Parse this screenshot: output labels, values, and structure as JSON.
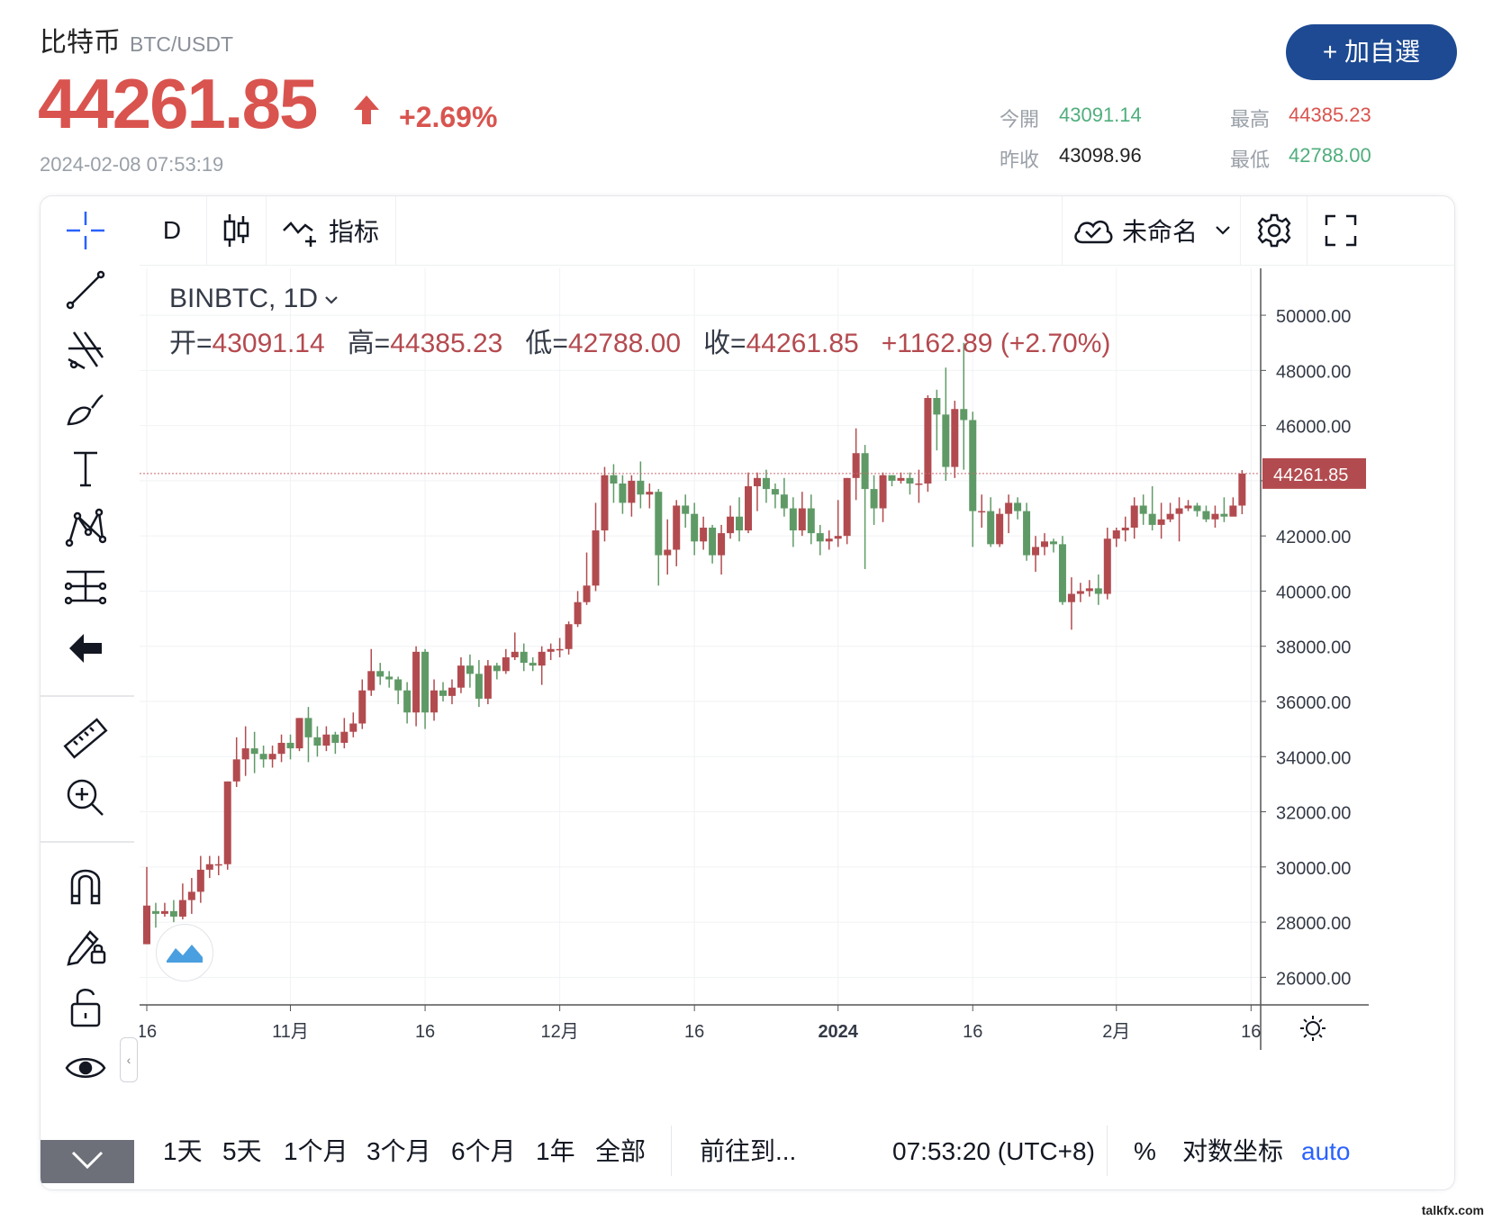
{
  "asset": {
    "name": "比特币",
    "pair": "BTC/USDT"
  },
  "price": {
    "last": "44261.85",
    "change": "+2.69%",
    "timestamp": "2024-02-08 07:53:19"
  },
  "watch_button": "+ 加自選",
  "quote": {
    "open_label": "今開",
    "open": "43091.14",
    "high_label": "最高",
    "high": "44385.23",
    "prev_label": "昨收",
    "prev": "43098.96",
    "low_label": "最低",
    "low": "42788.00"
  },
  "toolbar": {
    "interval": "D",
    "indicators": "指标",
    "layout_name": "未命名"
  },
  "legend": {
    "symbol": "BINBTC, 1D",
    "o_label": "开=",
    "o": "43091.14",
    "h_label": "高=",
    "h": "44385.23",
    "l_label": "低=",
    "l": "42788.00",
    "c_label": "收=",
    "c": "44261.85",
    "chg": "+1162.89 (+2.70%)"
  },
  "bottom": {
    "ranges": [
      "1天",
      "5天",
      "1个月",
      "3个月",
      "6个月",
      "1年",
      "全部"
    ],
    "goto": "前往到...",
    "clock": "07:53:20 (UTC+8)",
    "percent": "%",
    "log": "对数坐标",
    "auto": "auto"
  },
  "colors": {
    "up": "#b24b4f",
    "down": "#5f9a66",
    "accent": "#1e4a93",
    "price_red": "#d9544f",
    "quote_green": "#4fae7c"
  },
  "chart_data": {
    "type": "candlestick",
    "symbol": "BINBTC",
    "interval": "1D",
    "y_ticks": [
      26000,
      28000,
      30000,
      32000,
      34000,
      36000,
      38000,
      40000,
      42000,
      44000,
      46000,
      48000,
      50000
    ],
    "ylim": [
      25000,
      51700
    ],
    "x_ticks": [
      {
        "label": "16",
        "index": 0
      },
      {
        "label": "11月",
        "index": 16
      },
      {
        "label": "16",
        "index": 31
      },
      {
        "label": "12月",
        "index": 46
      },
      {
        "label": "16",
        "index": 61
      },
      {
        "label": "2024",
        "index": 77
      },
      {
        "label": "16",
        "index": 92
      },
      {
        "label": "2月",
        "index": 108
      },
      {
        "label": "16",
        "index": 123
      }
    ],
    "last_price_label": "44261.85",
    "last_price": 44262,
    "candles": [
      [
        27200,
        28600,
        27200,
        30000
      ],
      [
        28400,
        28300,
        27800,
        28700
      ],
      [
        28300,
        28400,
        28200,
        28700
      ],
      [
        28400,
        28200,
        28000,
        28800
      ],
      [
        28200,
        28800,
        28100,
        29400
      ],
      [
        28800,
        29100,
        28300,
        29600
      ],
      [
        29100,
        29900,
        28700,
        30400
      ],
      [
        29900,
        30100,
        29600,
        30400
      ],
      [
        30100,
        30100,
        29700,
        30400
      ],
      [
        30100,
        33100,
        29900,
        33100
      ],
      [
        33100,
        33900,
        32900,
        34700
      ],
      [
        33900,
        34300,
        33300,
        35100
      ],
      [
        34300,
        34100,
        33400,
        34900
      ],
      [
        34100,
        33900,
        33600,
        34400
      ],
      [
        33900,
        34100,
        33600,
        34400
      ],
      [
        34100,
        34500,
        33800,
        34800
      ],
      [
        34500,
        34300,
        33900,
        34800
      ],
      [
        34300,
        35400,
        34200,
        35400
      ],
      [
        35400,
        34700,
        33800,
        35800
      ],
      [
        34700,
        34400,
        34000,
        35100
      ],
      [
        34400,
        34800,
        34200,
        35100
      ],
      [
        34800,
        34500,
        34100,
        34900
      ],
      [
        34500,
        34900,
        34300,
        35400
      ],
      [
        34900,
        35200,
        34700,
        35600
      ],
      [
        35200,
        36400,
        35000,
        36800
      ],
      [
        36400,
        37100,
        36200,
        37900
      ],
      [
        37100,
        36900,
        36600,
        37400
      ],
      [
        36900,
        36800,
        36500,
        37100
      ],
      [
        36800,
        36400,
        35900,
        36900
      ],
      [
        36400,
        35600,
        35200,
        36700
      ],
      [
        35600,
        37800,
        35100,
        38000
      ],
      [
        37800,
        35600,
        35000,
        37900
      ],
      [
        35600,
        36400,
        35300,
        36800
      ],
      [
        36400,
        36200,
        36000,
        36700
      ],
      [
        36200,
        36500,
        35900,
        36800
      ],
      [
        36500,
        37300,
        36300,
        37600
      ],
      [
        37300,
        37000,
        36500,
        37700
      ],
      [
        37000,
        36100,
        35800,
        37500
      ],
      [
        36100,
        37300,
        35900,
        37500
      ],
      [
        37300,
        37100,
        36800,
        37400
      ],
      [
        37100,
        37600,
        37000,
        37900
      ],
      [
        37600,
        37800,
        37500,
        38500
      ],
      [
        37800,
        37400,
        37100,
        38100
      ],
      [
        37400,
        37300,
        37100,
        37600
      ],
      [
        37300,
        37800,
        36600,
        38000
      ],
      [
        37800,
        37900,
        37500,
        38100
      ],
      [
        37900,
        37900,
        37600,
        38300
      ],
      [
        37900,
        38800,
        37700,
        38900
      ],
      [
        38800,
        39600,
        38700,
        40000
      ],
      [
        39600,
        40200,
        39500,
        41400
      ],
      [
        40200,
        42200,
        40000,
        43200
      ],
      [
        42200,
        44200,
        41800,
        44500
      ],
      [
        44200,
        43900,
        43200,
        44600
      ],
      [
        43900,
        43200,
        42800,
        44200
      ],
      [
        43200,
        44000,
        42700,
        44200
      ],
      [
        44000,
        43500,
        43000,
        44700
      ],
      [
        43500,
        43600,
        43000,
        43900
      ],
      [
        43600,
        41300,
        40200,
        43700
      ],
      [
        41300,
        41500,
        40600,
        42600
      ],
      [
        41500,
        43100,
        40900,
        43300
      ],
      [
        43100,
        42800,
        42300,
        43500
      ],
      [
        42800,
        41800,
        41300,
        43200
      ],
      [
        41800,
        42300,
        41500,
        42700
      ],
      [
        42300,
        41300,
        41000,
        42400
      ],
      [
        41300,
        42100,
        40600,
        42400
      ],
      [
        42100,
        42700,
        41900,
        43100
      ],
      [
        42700,
        42200,
        41800,
        43400
      ],
      [
        42200,
        43800,
        42100,
        44300
      ],
      [
        43800,
        44100,
        42900,
        44300
      ],
      [
        44100,
        43700,
        43200,
        44400
      ],
      [
        43700,
        43500,
        43000,
        43900
      ],
      [
        43500,
        43000,
        42700,
        44100
      ],
      [
        43000,
        42200,
        41600,
        43400
      ],
      [
        42200,
        43000,
        42000,
        43600
      ],
      [
        43000,
        42100,
        41700,
        43500
      ],
      [
        42100,
        41800,
        41300,
        42400
      ],
      [
        41800,
        41900,
        41500,
        42200
      ],
      [
        41900,
        42000,
        41600,
        43300
      ],
      [
        42000,
        44100,
        41700,
        44100
      ],
      [
        44100,
        45000,
        43300,
        45900
      ],
      [
        45000,
        43700,
        40800,
        45300
      ],
      [
        43700,
        43000,
        42400,
        44200
      ],
      [
        43000,
        44200,
        42500,
        44300
      ],
      [
        44200,
        44000,
        43800,
        44200
      ],
      [
        44000,
        44100,
        43900,
        44300
      ],
      [
        44100,
        43900,
        43500,
        44300
      ],
      [
        43900,
        43900,
        43200,
        44400
      ],
      [
        43900,
        47000,
        43600,
        47100
      ],
      [
        47000,
        46400,
        45100,
        47300
      ],
      [
        46400,
        44500,
        44000,
        48100
      ],
      [
        44500,
        46600,
        44100,
        46900
      ],
      [
        46600,
        46200,
        44400,
        49000
      ],
      [
        46200,
        42900,
        41600,
        46500
      ],
      [
        42900,
        42900,
        42300,
        43500
      ],
      [
        42900,
        41700,
        41600,
        43400
      ],
      [
        41700,
        42800,
        41600,
        43000
      ],
      [
        42800,
        43200,
        42100,
        43500
      ],
      [
        43200,
        42900,
        42600,
        43400
      ],
      [
        42900,
        41300,
        41100,
        43200
      ],
      [
        41300,
        41600,
        40700,
        42000
      ],
      [
        41600,
        41800,
        41300,
        42100
      ],
      [
        41800,
        41700,
        41400,
        41900
      ],
      [
        41700,
        39600,
        39500,
        42000
      ],
      [
        39600,
        39900,
        38600,
        40500
      ],
      [
        39900,
        40000,
        39600,
        40300
      ],
      [
        40000,
        40100,
        39800,
        40400
      ],
      [
        40100,
        39900,
        39500,
        40600
      ],
      [
        39900,
        41900,
        39700,
        42300
      ],
      [
        41900,
        42200,
        41600,
        42300
      ],
      [
        42200,
        42300,
        41800,
        42700
      ],
      [
        42300,
        43100,
        41900,
        43400
      ],
      [
        43100,
        42800,
        42400,
        43500
      ],
      [
        42800,
        42400,
        42200,
        43800
      ],
      [
        42400,
        42600,
        41900,
        43200
      ],
      [
        42600,
        42800,
        42500,
        43200
      ],
      [
        42800,
        43000,
        41800,
        43400
      ],
      [
        43000,
        43100,
        42900,
        43300
      ],
      [
        43100,
        42900,
        42700,
        43200
      ],
      [
        42900,
        42600,
        42500,
        43100
      ],
      [
        42600,
        42800,
        42300,
        43100
      ],
      [
        42800,
        42700,
        42500,
        43400
      ],
      [
        42700,
        43100,
        42800,
        43400
      ],
      [
        43100,
        44262,
        42788,
        44385
      ]
    ]
  }
}
